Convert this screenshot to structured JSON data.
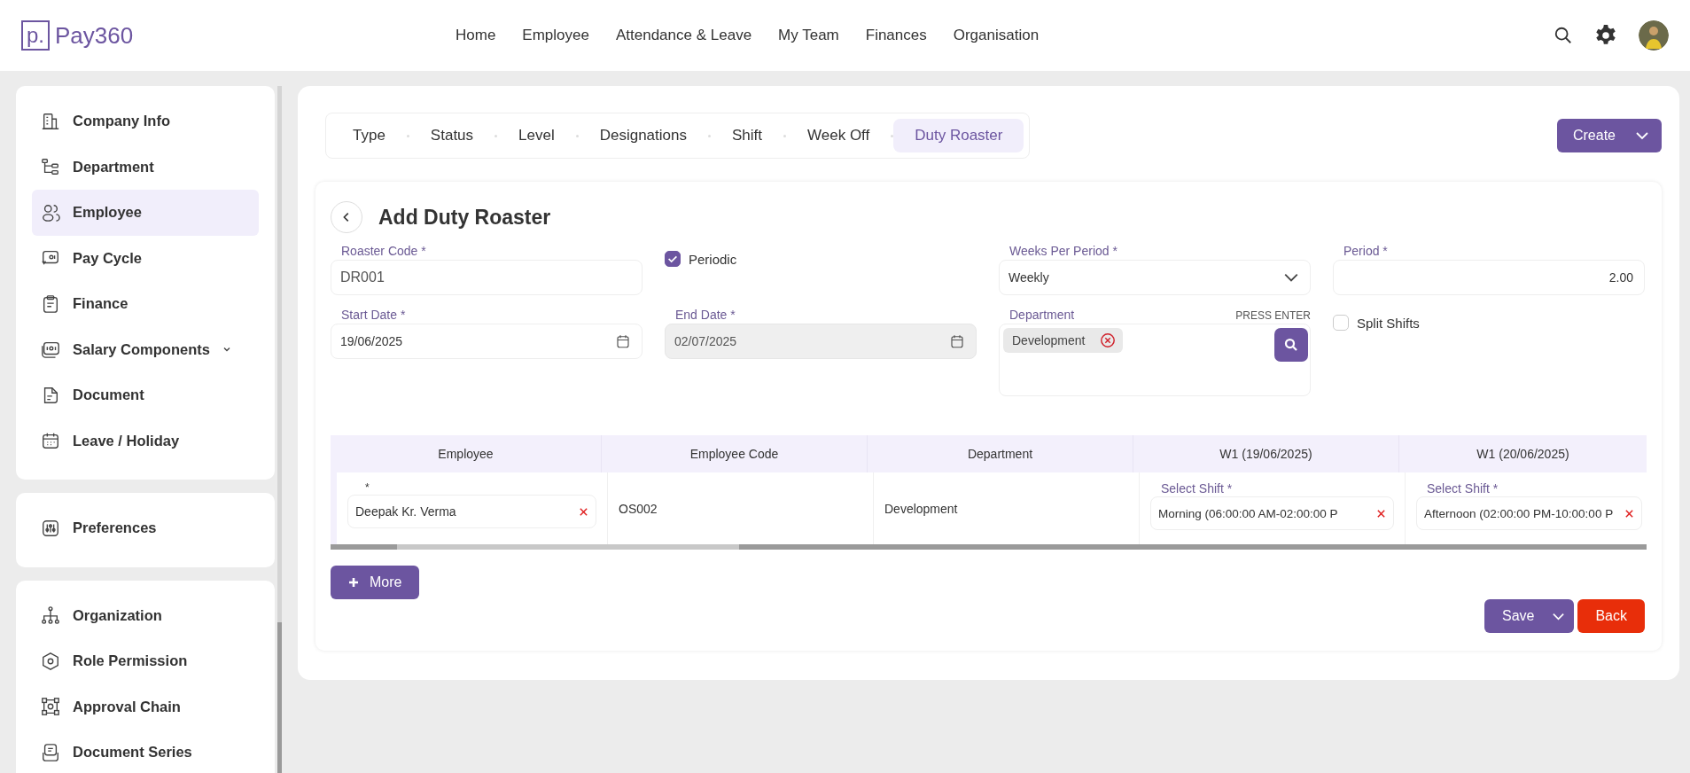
{
  "brand": {
    "mark": "p.",
    "name": "Pay360"
  },
  "nav": [
    "Home",
    "Employee",
    "Attendance & Leave",
    "My Team",
    "Finances",
    "Organisation"
  ],
  "sidebar": {
    "groups": [
      {
        "items": [
          {
            "label": "Company Info",
            "selected": false,
            "expandable": false
          },
          {
            "label": "Department",
            "selected": false,
            "expandable": false
          },
          {
            "label": "Employee",
            "selected": true,
            "expandable": false
          },
          {
            "label": "Pay Cycle",
            "selected": false,
            "expandable": false
          },
          {
            "label": "Finance",
            "selected": false,
            "expandable": false
          },
          {
            "label": "Salary Components",
            "selected": false,
            "expandable": true
          },
          {
            "label": "Document",
            "selected": false,
            "expandable": false
          },
          {
            "label": "Leave / Holiday",
            "selected": false,
            "expandable": false
          }
        ]
      },
      {
        "items": [
          {
            "label": "Preferences",
            "selected": false,
            "expandable": false
          }
        ]
      },
      {
        "items": [
          {
            "label": "Organization",
            "selected": false,
            "expandable": false
          },
          {
            "label": "Role Permission",
            "selected": false,
            "expandable": false
          },
          {
            "label": "Approval Chain",
            "selected": false,
            "expandable": false
          },
          {
            "label": "Document Series",
            "selected": false,
            "expandable": false
          }
        ]
      }
    ]
  },
  "tabs": [
    {
      "label": "Type",
      "selected": false
    },
    {
      "label": "Status",
      "selected": false
    },
    {
      "label": "Level",
      "selected": false
    },
    {
      "label": "Designations",
      "selected": false
    },
    {
      "label": "Shift",
      "selected": false
    },
    {
      "label": "Week Off",
      "selected": false
    },
    {
      "label": "Duty Roaster",
      "selected": true
    }
  ],
  "create_button": "Create",
  "form": {
    "title": "Add Duty Roaster",
    "roaster_code": {
      "label": "Roaster Code *",
      "value": "DR001"
    },
    "periodic": {
      "label": "Periodic",
      "checked": true
    },
    "weeks_per_period": {
      "label": "Weeks Per Period *",
      "value": "Weekly"
    },
    "period": {
      "label": "Period *",
      "value": "2.00"
    },
    "start_date": {
      "label": "Start Date *",
      "value": "19/06/2025",
      "disabled": false
    },
    "end_date": {
      "label": "End Date *",
      "value": "02/07/2025",
      "disabled": true
    },
    "department": {
      "label": "Department",
      "hint": "PRESS ENTER",
      "tags": [
        "Development"
      ]
    },
    "split_shifts": {
      "label": "Split Shifts",
      "checked": false
    }
  },
  "table": {
    "columns": [
      "Employee",
      "Employee Code",
      "Department",
      "W1 (19/06/2025)",
      "W1 (20/06/2025)"
    ],
    "rows": [
      {
        "employee_label": "*",
        "employee": "Deepak Kr. Verma",
        "code": "OS002",
        "department": "Development",
        "shifts": [
          {
            "label": "Select Shift *",
            "value": "Morning (06:00:00 AM-02:00:00 P"
          },
          {
            "label": "Select Shift *",
            "value": "Afternoon (02:00:00 PM-10:00:00 P"
          }
        ]
      }
    ]
  },
  "more_button": "More",
  "save_button": "Save",
  "back_button": "Back"
}
